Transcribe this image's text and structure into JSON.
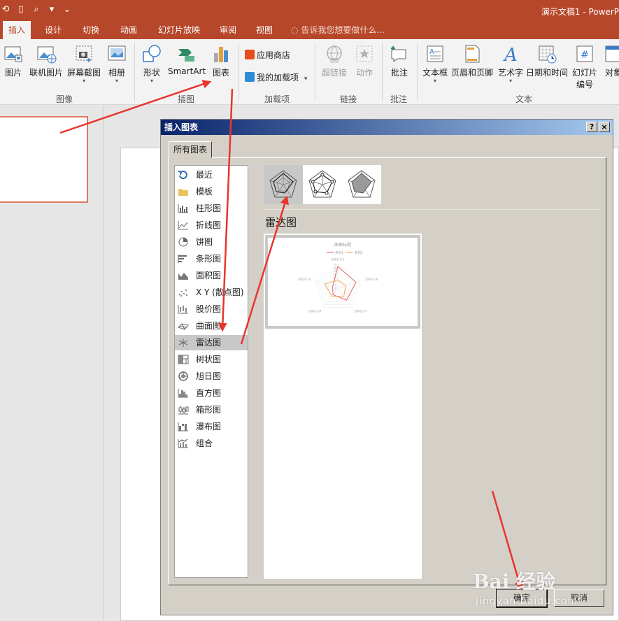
{
  "window": {
    "title": "演示文稿1 - PowerP"
  },
  "colors": {
    "accent": "#b7472a",
    "annotation_arrow": "#e8352e",
    "selection": "#c8c8c8",
    "dialog_face": "#d4d0c8"
  },
  "ribbon_tabs": [
    {
      "label": "插入",
      "active": true
    },
    {
      "label": "设计"
    },
    {
      "label": "切换"
    },
    {
      "label": "动画"
    },
    {
      "label": "幻灯片放映"
    },
    {
      "label": "审阅"
    },
    {
      "label": "视图"
    }
  ],
  "tell_me": {
    "icon": "lightbulb-icon",
    "text": "告诉我您想要做什么..."
  },
  "ribbon": {
    "images": {
      "group_label": "图像",
      "picture": "图片",
      "online_picture": "联机图片",
      "screenshot": "屏幕截图",
      "album": "相册"
    },
    "illustrations": {
      "group_label": "插图",
      "shapes": "形状",
      "smartart": "SmartArt",
      "chart": "图表"
    },
    "addins": {
      "group_label": "加载项",
      "store": "应用商店",
      "my_addins": "我的加载项"
    },
    "links": {
      "group_label": "链接",
      "hyperlink": "超链接",
      "action": "动作"
    },
    "comments": {
      "group_label": "批注",
      "comment": "批注"
    },
    "text": {
      "group_label": "文本",
      "textbox": "文本框",
      "header_footer": "页眉和页脚",
      "wordart": "艺术字",
      "datetime": "日期和时间",
      "slide_number_line1": "幻灯片",
      "slide_number_line2": "编号",
      "object": "对象"
    }
  },
  "dialog": {
    "title": "插入图表",
    "help_button": "?",
    "close_button": "×",
    "tab": "所有图表",
    "chart_types": [
      {
        "label": "最近",
        "icon": "recent-icon"
      },
      {
        "label": "模板",
        "icon": "template-folder-icon"
      },
      {
        "label": "柱形图",
        "icon": "column-chart-icon"
      },
      {
        "label": "折线图",
        "icon": "line-chart-icon"
      },
      {
        "label": "饼图",
        "icon": "pie-chart-icon"
      },
      {
        "label": "条形图",
        "icon": "bar-chart-icon"
      },
      {
        "label": "面积图",
        "icon": "area-chart-icon"
      },
      {
        "label": "X Y (散点图)",
        "icon": "scatter-chart-icon"
      },
      {
        "label": "股价图",
        "icon": "stock-chart-icon"
      },
      {
        "label": "曲面图",
        "icon": "surface-chart-icon"
      },
      {
        "label": "雷达图",
        "icon": "radar-chart-icon",
        "selected": true
      },
      {
        "label": "树状图",
        "icon": "treemap-chart-icon"
      },
      {
        "label": "旭日图",
        "icon": "sunburst-chart-icon"
      },
      {
        "label": "直方图",
        "icon": "histogram-chart-icon"
      },
      {
        "label": "箱形图",
        "icon": "boxplot-chart-icon"
      },
      {
        "label": "瀑布图",
        "icon": "waterfall-chart-icon"
      },
      {
        "label": "组合",
        "icon": "combo-chart-icon"
      }
    ],
    "subtypes": [
      {
        "icon": "radar-basic-icon",
        "selected": true
      },
      {
        "icon": "radar-markers-icon"
      },
      {
        "icon": "radar-filled-icon"
      }
    ],
    "selected_subtype_name": "雷达图",
    "preview": {
      "title": "图表标题",
      "legend": [
        "系列1",
        "系列2"
      ],
      "series_colors": [
        "#e05656",
        "#f0a04b"
      ],
      "axis_labels": [
        "2002-1-5",
        "2002-1-6",
        "2002-1-7",
        "2002-1-8",
        "2002-1-9"
      ],
      "ticks": [
        "35",
        "30",
        "25",
        "20",
        "15",
        "10",
        "5",
        "0"
      ],
      "series1": [
        32,
        28,
        22,
        12,
        8
      ],
      "series2": [
        12,
        12,
        15,
        15,
        20
      ],
      "max": 35
    },
    "ok_button": "确定",
    "cancel_button": "取消"
  },
  "watermark": {
    "brand": "Bai 经验",
    "url": "jingyan.baidu.com"
  }
}
